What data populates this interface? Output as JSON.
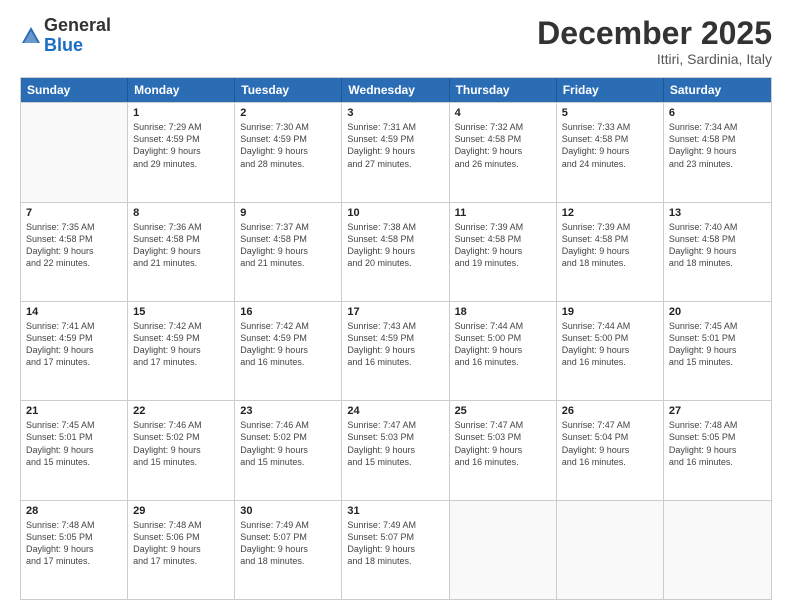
{
  "header": {
    "logo_line1": "General",
    "logo_line2": "Blue",
    "month": "December 2025",
    "location": "Ittiri, Sardinia, Italy"
  },
  "weekdays": [
    "Sunday",
    "Monday",
    "Tuesday",
    "Wednesday",
    "Thursday",
    "Friday",
    "Saturday"
  ],
  "rows": [
    [
      {
        "day": "",
        "info": ""
      },
      {
        "day": "1",
        "info": "Sunrise: 7:29 AM\nSunset: 4:59 PM\nDaylight: 9 hours\nand 29 minutes."
      },
      {
        "day": "2",
        "info": "Sunrise: 7:30 AM\nSunset: 4:59 PM\nDaylight: 9 hours\nand 28 minutes."
      },
      {
        "day": "3",
        "info": "Sunrise: 7:31 AM\nSunset: 4:59 PM\nDaylight: 9 hours\nand 27 minutes."
      },
      {
        "day": "4",
        "info": "Sunrise: 7:32 AM\nSunset: 4:58 PM\nDaylight: 9 hours\nand 26 minutes."
      },
      {
        "day": "5",
        "info": "Sunrise: 7:33 AM\nSunset: 4:58 PM\nDaylight: 9 hours\nand 24 minutes."
      },
      {
        "day": "6",
        "info": "Sunrise: 7:34 AM\nSunset: 4:58 PM\nDaylight: 9 hours\nand 23 minutes."
      }
    ],
    [
      {
        "day": "7",
        "info": "Sunrise: 7:35 AM\nSunset: 4:58 PM\nDaylight: 9 hours\nand 22 minutes."
      },
      {
        "day": "8",
        "info": "Sunrise: 7:36 AM\nSunset: 4:58 PM\nDaylight: 9 hours\nand 21 minutes."
      },
      {
        "day": "9",
        "info": "Sunrise: 7:37 AM\nSunset: 4:58 PM\nDaylight: 9 hours\nand 21 minutes."
      },
      {
        "day": "10",
        "info": "Sunrise: 7:38 AM\nSunset: 4:58 PM\nDaylight: 9 hours\nand 20 minutes."
      },
      {
        "day": "11",
        "info": "Sunrise: 7:39 AM\nSunset: 4:58 PM\nDaylight: 9 hours\nand 19 minutes."
      },
      {
        "day": "12",
        "info": "Sunrise: 7:39 AM\nSunset: 4:58 PM\nDaylight: 9 hours\nand 18 minutes."
      },
      {
        "day": "13",
        "info": "Sunrise: 7:40 AM\nSunset: 4:58 PM\nDaylight: 9 hours\nand 18 minutes."
      }
    ],
    [
      {
        "day": "14",
        "info": "Sunrise: 7:41 AM\nSunset: 4:59 PM\nDaylight: 9 hours\nand 17 minutes."
      },
      {
        "day": "15",
        "info": "Sunrise: 7:42 AM\nSunset: 4:59 PM\nDaylight: 9 hours\nand 17 minutes."
      },
      {
        "day": "16",
        "info": "Sunrise: 7:42 AM\nSunset: 4:59 PM\nDaylight: 9 hours\nand 16 minutes."
      },
      {
        "day": "17",
        "info": "Sunrise: 7:43 AM\nSunset: 4:59 PM\nDaylight: 9 hours\nand 16 minutes."
      },
      {
        "day": "18",
        "info": "Sunrise: 7:44 AM\nSunset: 5:00 PM\nDaylight: 9 hours\nand 16 minutes."
      },
      {
        "day": "19",
        "info": "Sunrise: 7:44 AM\nSunset: 5:00 PM\nDaylight: 9 hours\nand 16 minutes."
      },
      {
        "day": "20",
        "info": "Sunrise: 7:45 AM\nSunset: 5:01 PM\nDaylight: 9 hours\nand 15 minutes."
      }
    ],
    [
      {
        "day": "21",
        "info": "Sunrise: 7:45 AM\nSunset: 5:01 PM\nDaylight: 9 hours\nand 15 minutes."
      },
      {
        "day": "22",
        "info": "Sunrise: 7:46 AM\nSunset: 5:02 PM\nDaylight: 9 hours\nand 15 minutes."
      },
      {
        "day": "23",
        "info": "Sunrise: 7:46 AM\nSunset: 5:02 PM\nDaylight: 9 hours\nand 15 minutes."
      },
      {
        "day": "24",
        "info": "Sunrise: 7:47 AM\nSunset: 5:03 PM\nDaylight: 9 hours\nand 15 minutes."
      },
      {
        "day": "25",
        "info": "Sunrise: 7:47 AM\nSunset: 5:03 PM\nDaylight: 9 hours\nand 16 minutes."
      },
      {
        "day": "26",
        "info": "Sunrise: 7:47 AM\nSunset: 5:04 PM\nDaylight: 9 hours\nand 16 minutes."
      },
      {
        "day": "27",
        "info": "Sunrise: 7:48 AM\nSunset: 5:05 PM\nDaylight: 9 hours\nand 16 minutes."
      }
    ],
    [
      {
        "day": "28",
        "info": "Sunrise: 7:48 AM\nSunset: 5:05 PM\nDaylight: 9 hours\nand 17 minutes."
      },
      {
        "day": "29",
        "info": "Sunrise: 7:48 AM\nSunset: 5:06 PM\nDaylight: 9 hours\nand 17 minutes."
      },
      {
        "day": "30",
        "info": "Sunrise: 7:49 AM\nSunset: 5:07 PM\nDaylight: 9 hours\nand 18 minutes."
      },
      {
        "day": "31",
        "info": "Sunrise: 7:49 AM\nSunset: 5:07 PM\nDaylight: 9 hours\nand 18 minutes."
      },
      {
        "day": "",
        "info": ""
      },
      {
        "day": "",
        "info": ""
      },
      {
        "day": "",
        "info": ""
      }
    ]
  ]
}
